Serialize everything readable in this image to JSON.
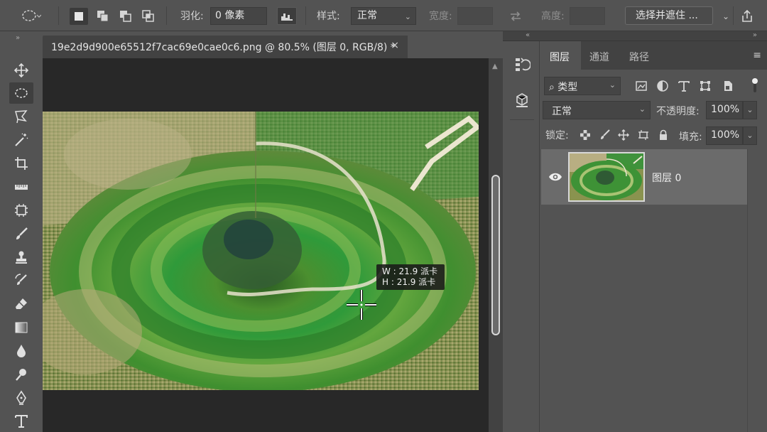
{
  "options_bar": {
    "feather_label": "羽化:",
    "feather_value": "0 像素",
    "style_label": "样式:",
    "style_value": "正常",
    "width_label": "宽度:",
    "height_label": "高度:",
    "select_mask_button": "选择并遮住 ..."
  },
  "document": {
    "tab_title": "19e2d9d900e65512f7cac69e0cae0c6.png @ 80.5% (图层 0, RGB/8) *",
    "close_glyph": "×"
  },
  "tooltip": {
    "width_line": "W : 21.9 派卡",
    "height_line": "H : 21.9 派卡"
  },
  "layers_panel": {
    "tabs": [
      {
        "label": "图层",
        "active": true
      },
      {
        "label": "通道",
        "active": false
      },
      {
        "label": "路径",
        "active": false
      }
    ],
    "filter_value": "类型",
    "blend_mode": "正常",
    "opacity_label": "不透明度:",
    "opacity_value": "100%",
    "lock_label": "锁定:",
    "fill_label": "填充:",
    "fill_value": "100%",
    "layers": [
      {
        "name": "图层 0",
        "visible": true
      }
    ]
  },
  "colors": {
    "ui_bg": "#535353",
    "panel_dark": "#424242",
    "canvas_bg": "#282828",
    "selected_layer": "#6b6b6b"
  }
}
